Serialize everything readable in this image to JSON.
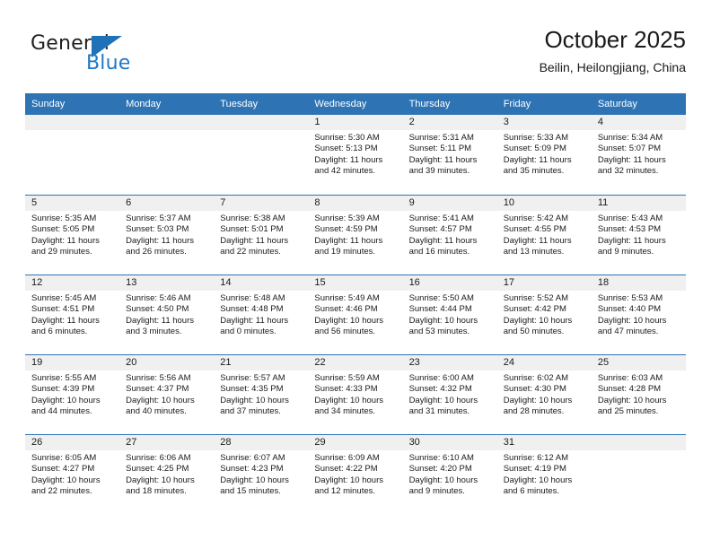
{
  "brand": {
    "name_part1": "General",
    "name_part2": "Blue",
    "triangle_color": "#1f72b8"
  },
  "header": {
    "month_title": "October 2025",
    "location": "Beilin, Heilongjiang, China"
  },
  "theme": {
    "header_blue": "#2e74b5",
    "day_band_grey": "#f0f0f0",
    "text_color": "#1a1a1a"
  },
  "calendar": {
    "weekdays": [
      "Sunday",
      "Monday",
      "Tuesday",
      "Wednesday",
      "Thursday",
      "Friday",
      "Saturday"
    ],
    "weeks": [
      [
        {
          "day": "",
          "lines": []
        },
        {
          "day": "",
          "lines": []
        },
        {
          "day": "",
          "lines": []
        },
        {
          "day": "1",
          "lines": [
            "Sunrise: 5:30 AM",
            "Sunset: 5:13 PM",
            "Daylight: 11 hours",
            "and 42 minutes."
          ]
        },
        {
          "day": "2",
          "lines": [
            "Sunrise: 5:31 AM",
            "Sunset: 5:11 PM",
            "Daylight: 11 hours",
            "and 39 minutes."
          ]
        },
        {
          "day": "3",
          "lines": [
            "Sunrise: 5:33 AM",
            "Sunset: 5:09 PM",
            "Daylight: 11 hours",
            "and 35 minutes."
          ]
        },
        {
          "day": "4",
          "lines": [
            "Sunrise: 5:34 AM",
            "Sunset: 5:07 PM",
            "Daylight: 11 hours",
            "and 32 minutes."
          ]
        }
      ],
      [
        {
          "day": "5",
          "lines": [
            "Sunrise: 5:35 AM",
            "Sunset: 5:05 PM",
            "Daylight: 11 hours",
            "and 29 minutes."
          ]
        },
        {
          "day": "6",
          "lines": [
            "Sunrise: 5:37 AM",
            "Sunset: 5:03 PM",
            "Daylight: 11 hours",
            "and 26 minutes."
          ]
        },
        {
          "day": "7",
          "lines": [
            "Sunrise: 5:38 AM",
            "Sunset: 5:01 PM",
            "Daylight: 11 hours",
            "and 22 minutes."
          ]
        },
        {
          "day": "8",
          "lines": [
            "Sunrise: 5:39 AM",
            "Sunset: 4:59 PM",
            "Daylight: 11 hours",
            "and 19 minutes."
          ]
        },
        {
          "day": "9",
          "lines": [
            "Sunrise: 5:41 AM",
            "Sunset: 4:57 PM",
            "Daylight: 11 hours",
            "and 16 minutes."
          ]
        },
        {
          "day": "10",
          "lines": [
            "Sunrise: 5:42 AM",
            "Sunset: 4:55 PM",
            "Daylight: 11 hours",
            "and 13 minutes."
          ]
        },
        {
          "day": "11",
          "lines": [
            "Sunrise: 5:43 AM",
            "Sunset: 4:53 PM",
            "Daylight: 11 hours",
            "and 9 minutes."
          ]
        }
      ],
      [
        {
          "day": "12",
          "lines": [
            "Sunrise: 5:45 AM",
            "Sunset: 4:51 PM",
            "Daylight: 11 hours",
            "and 6 minutes."
          ]
        },
        {
          "day": "13",
          "lines": [
            "Sunrise: 5:46 AM",
            "Sunset: 4:50 PM",
            "Daylight: 11 hours",
            "and 3 minutes."
          ]
        },
        {
          "day": "14",
          "lines": [
            "Sunrise: 5:48 AM",
            "Sunset: 4:48 PM",
            "Daylight: 11 hours",
            "and 0 minutes."
          ]
        },
        {
          "day": "15",
          "lines": [
            "Sunrise: 5:49 AM",
            "Sunset: 4:46 PM",
            "Daylight: 10 hours",
            "and 56 minutes."
          ]
        },
        {
          "day": "16",
          "lines": [
            "Sunrise: 5:50 AM",
            "Sunset: 4:44 PM",
            "Daylight: 10 hours",
            "and 53 minutes."
          ]
        },
        {
          "day": "17",
          "lines": [
            "Sunrise: 5:52 AM",
            "Sunset: 4:42 PM",
            "Daylight: 10 hours",
            "and 50 minutes."
          ]
        },
        {
          "day": "18",
          "lines": [
            "Sunrise: 5:53 AM",
            "Sunset: 4:40 PM",
            "Daylight: 10 hours",
            "and 47 minutes."
          ]
        }
      ],
      [
        {
          "day": "19",
          "lines": [
            "Sunrise: 5:55 AM",
            "Sunset: 4:39 PM",
            "Daylight: 10 hours",
            "and 44 minutes."
          ]
        },
        {
          "day": "20",
          "lines": [
            "Sunrise: 5:56 AM",
            "Sunset: 4:37 PM",
            "Daylight: 10 hours",
            "and 40 minutes."
          ]
        },
        {
          "day": "21",
          "lines": [
            "Sunrise: 5:57 AM",
            "Sunset: 4:35 PM",
            "Daylight: 10 hours",
            "and 37 minutes."
          ]
        },
        {
          "day": "22",
          "lines": [
            "Sunrise: 5:59 AM",
            "Sunset: 4:33 PM",
            "Daylight: 10 hours",
            "and 34 minutes."
          ]
        },
        {
          "day": "23",
          "lines": [
            "Sunrise: 6:00 AM",
            "Sunset: 4:32 PM",
            "Daylight: 10 hours",
            "and 31 minutes."
          ]
        },
        {
          "day": "24",
          "lines": [
            "Sunrise: 6:02 AM",
            "Sunset: 4:30 PM",
            "Daylight: 10 hours",
            "and 28 minutes."
          ]
        },
        {
          "day": "25",
          "lines": [
            "Sunrise: 6:03 AM",
            "Sunset: 4:28 PM",
            "Daylight: 10 hours",
            "and 25 minutes."
          ]
        }
      ],
      [
        {
          "day": "26",
          "lines": [
            "Sunrise: 6:05 AM",
            "Sunset: 4:27 PM",
            "Daylight: 10 hours",
            "and 22 minutes."
          ]
        },
        {
          "day": "27",
          "lines": [
            "Sunrise: 6:06 AM",
            "Sunset: 4:25 PM",
            "Daylight: 10 hours",
            "and 18 minutes."
          ]
        },
        {
          "day": "28",
          "lines": [
            "Sunrise: 6:07 AM",
            "Sunset: 4:23 PM",
            "Daylight: 10 hours",
            "and 15 minutes."
          ]
        },
        {
          "day": "29",
          "lines": [
            "Sunrise: 6:09 AM",
            "Sunset: 4:22 PM",
            "Daylight: 10 hours",
            "and 12 minutes."
          ]
        },
        {
          "day": "30",
          "lines": [
            "Sunrise: 6:10 AM",
            "Sunset: 4:20 PM",
            "Daylight: 10 hours",
            "and 9 minutes."
          ]
        },
        {
          "day": "31",
          "lines": [
            "Sunrise: 6:12 AM",
            "Sunset: 4:19 PM",
            "Daylight: 10 hours",
            "and 6 minutes."
          ]
        },
        {
          "day": "",
          "lines": []
        }
      ]
    ]
  }
}
